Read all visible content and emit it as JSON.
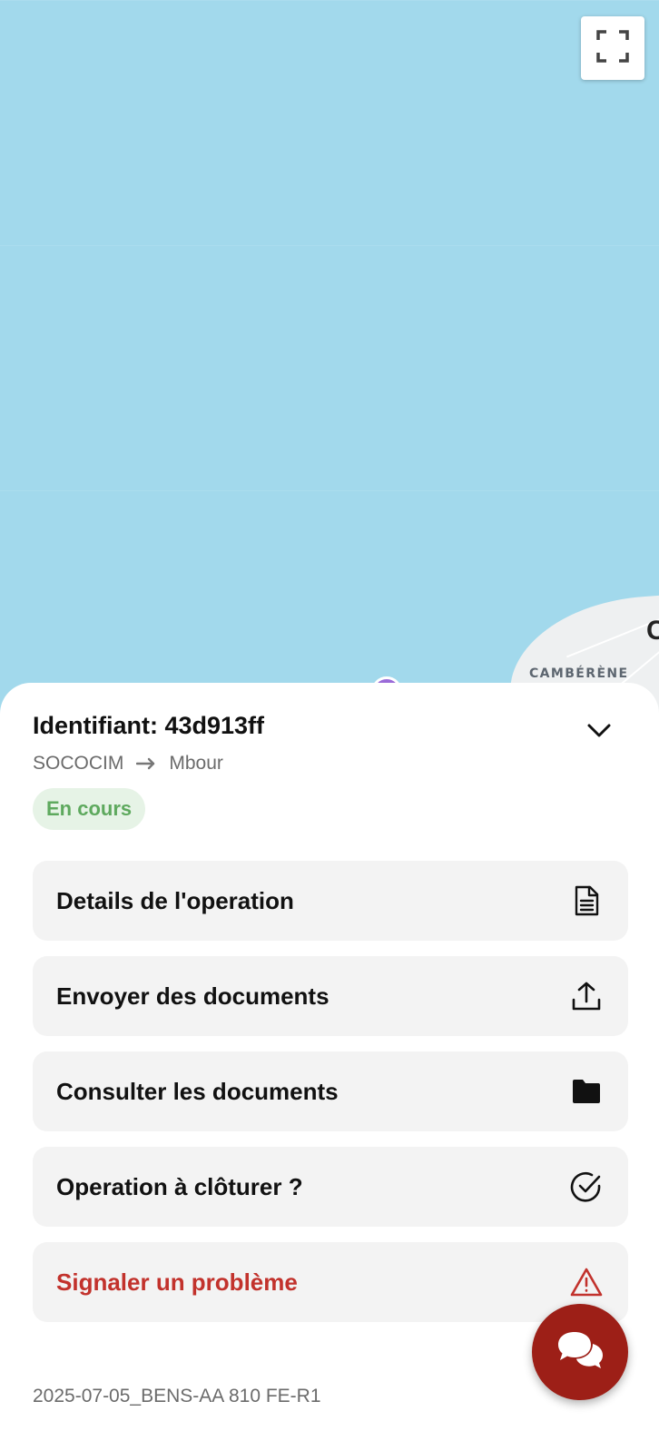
{
  "map": {
    "place_label": "CAMBÉRÈNE",
    "edge_letter": "C"
  },
  "operation": {
    "title": "Identifiant: 43d913ff",
    "origin": "SOCOCIM",
    "destination": "Mbour",
    "status": "En cours",
    "reference": "2025-07-05_BENS-AA 810 FE-R1"
  },
  "actions": [
    {
      "label": "Details de l'operation",
      "icon": "document-icon"
    },
    {
      "label": "Envoyer des documents",
      "icon": "upload-icon"
    },
    {
      "label": "Consulter les documents",
      "icon": "folder-icon"
    },
    {
      "label": "Operation à clôturer ?",
      "icon": "check-circle-icon"
    },
    {
      "label": "Signaler un problème",
      "icon": "warning-triangle-icon"
    }
  ],
  "colors": {
    "map_water": "#a2d9ec",
    "status_bg": "#e6f3e6",
    "status_text": "#5ea95e",
    "danger": "#c2322c",
    "chat_button": "#9d1f17"
  }
}
